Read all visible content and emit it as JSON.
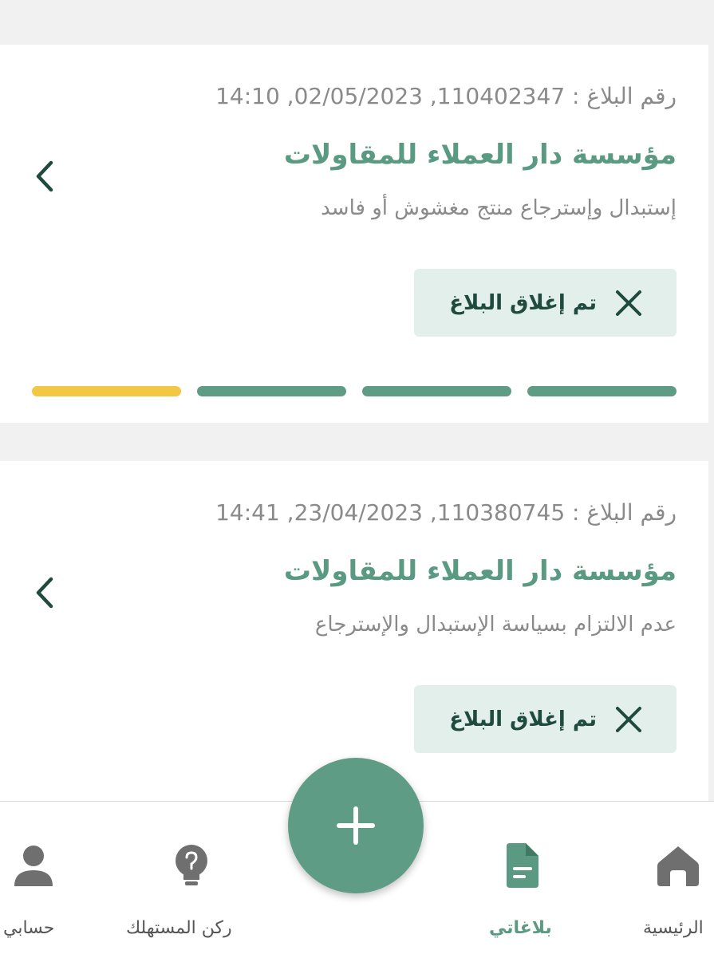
{
  "colors": {
    "accent_green": "#5b9a82",
    "fab_green": "#5f9c85",
    "status_bg": "#e3efea",
    "progress_done": "#5f9c85",
    "progress_current": "#f2c744"
  },
  "reports": [
    {
      "meta": "رقم البلاغ : 110402347, 02/05/2023, 14:10",
      "company": "مؤسسة دار العملاء للمقاولات",
      "description": "إستبدال وإسترجاع منتج مغشوش أو فاسد",
      "status": "تم إغلاق البلاغ",
      "status_icon": "close-x-icon",
      "progress_steps": [
        "done",
        "done",
        "done",
        "current"
      ]
    },
    {
      "meta": "رقم البلاغ : 110380745, 23/04/2023, 14:41",
      "company": "مؤسسة دار العملاء للمقاولات",
      "description": "عدم الالتزام بسياسة الإستبدال والإسترجاع",
      "status": "تم إغلاق البلاغ",
      "status_icon": "close-x-icon"
    }
  ],
  "nav": {
    "home": {
      "label": "الرئيسية",
      "icon": "home-icon"
    },
    "reports": {
      "label": "بلاغاتي",
      "icon": "document-icon",
      "active": true
    },
    "consumer": {
      "label": "ركن المستهلك",
      "icon": "lightbulb-icon"
    },
    "account": {
      "label": "حسابي",
      "icon": "person-icon"
    }
  },
  "fab": {
    "icon": "plus-icon"
  }
}
